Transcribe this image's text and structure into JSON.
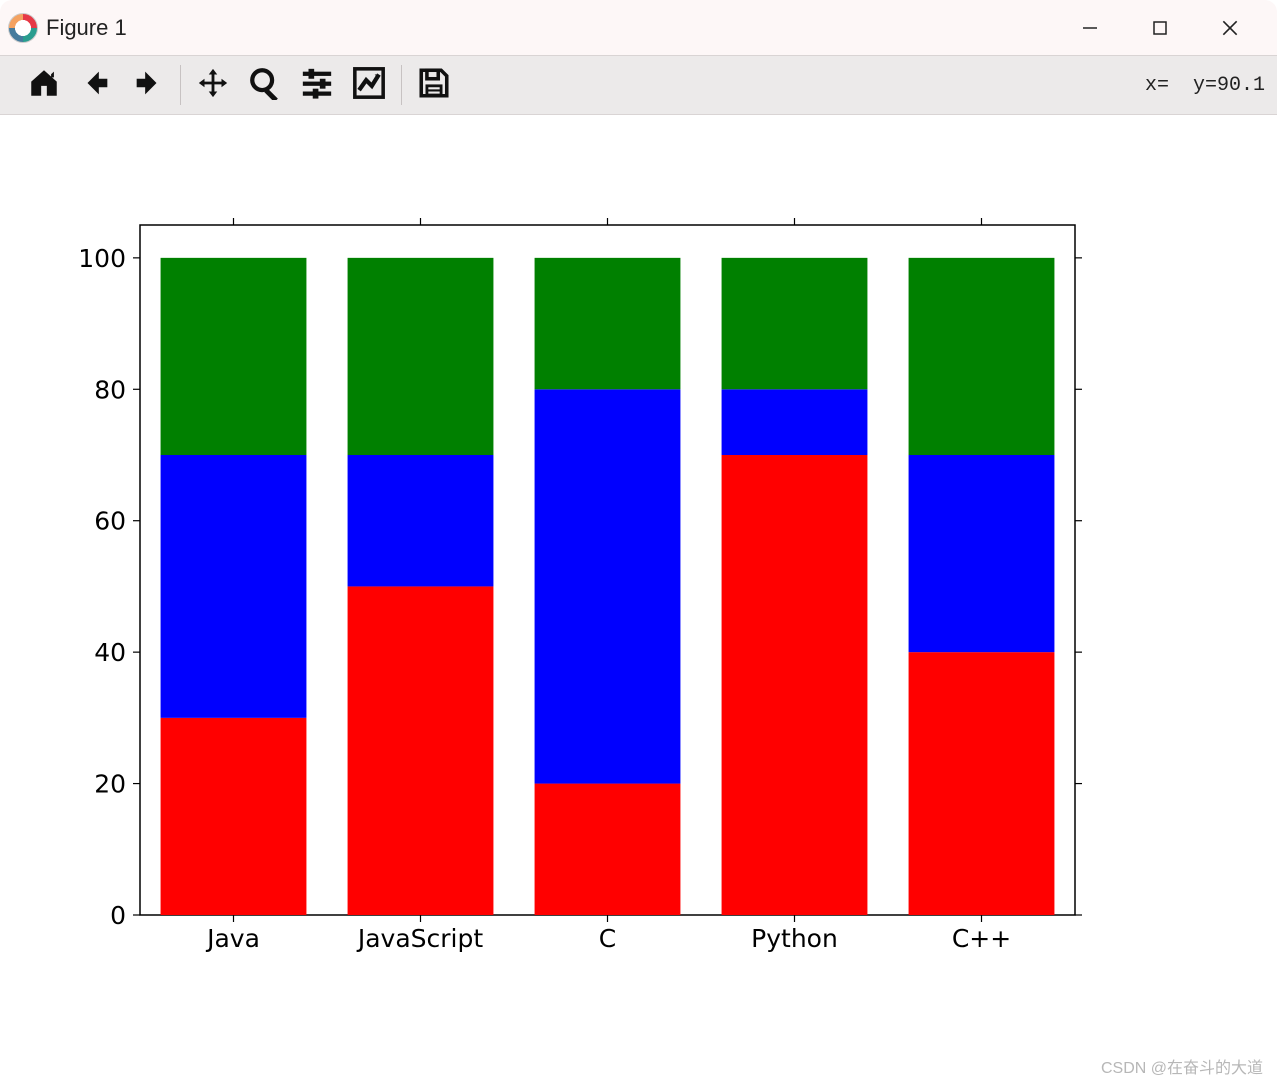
{
  "window": {
    "title": "Figure 1"
  },
  "toolbar": {
    "coords": "x=  y=90.1"
  },
  "watermark": "CSDN @在奋斗的大道",
  "chart_data": {
    "type": "bar",
    "stacked": true,
    "categories": [
      "Java",
      "JavaScript",
      "C",
      "Python",
      "C++"
    ],
    "series": [
      {
        "name": "red",
        "color": "#ff0000",
        "values": [
          30,
          50,
          20,
          70,
          40
        ]
      },
      {
        "name": "blue",
        "color": "#0000ff",
        "values": [
          40,
          20,
          60,
          10,
          30
        ]
      },
      {
        "name": "green",
        "color": "#008000",
        "values": [
          30,
          30,
          20,
          20,
          30
        ]
      }
    ],
    "yticks": [
      0,
      20,
      40,
      60,
      80,
      100
    ],
    "ylim": [
      0,
      105
    ],
    "xlabel": "",
    "ylabel": "",
    "title": ""
  }
}
